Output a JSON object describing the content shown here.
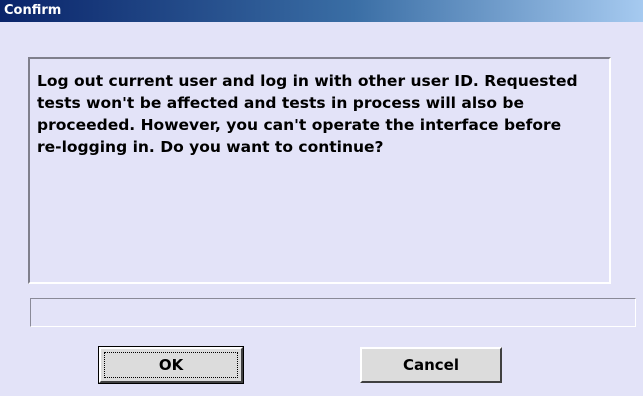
{
  "window": {
    "title": "Confirm"
  },
  "message": {
    "text": "Log out current user and log in with other user ID. Requested\ntests won't be affected and tests in process will also be\nproceeded. However, you can't operate the interface before\nre-logging in. Do you want to continue?"
  },
  "status": {
    "value": ""
  },
  "buttons": {
    "ok_label": "OK",
    "cancel_label": "Cancel"
  },
  "colors": {
    "dialog_background": "#e3e3f8",
    "title_bar_start": "#0a246a",
    "title_bar_end": "#a6caf0",
    "button_face": "#dcdcdc"
  }
}
